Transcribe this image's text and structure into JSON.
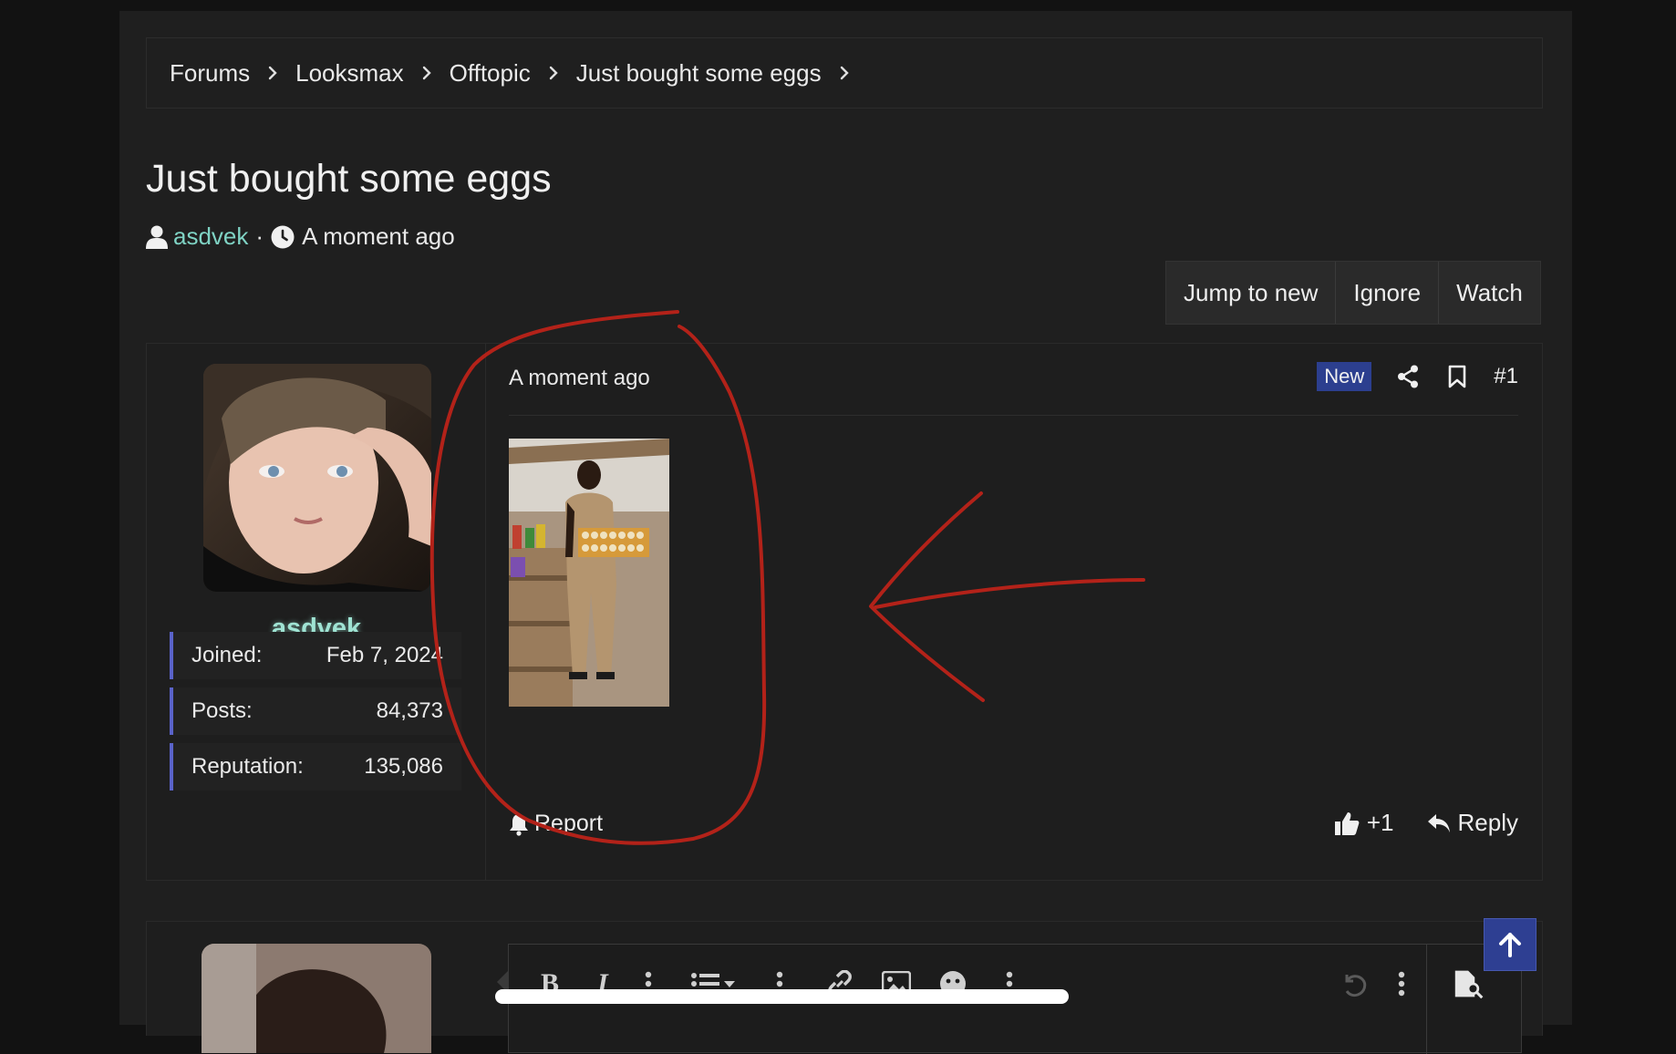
{
  "breadcrumb": {
    "items": [
      "Forums",
      "Looksmax",
      "Offtopic",
      "Just bought some eggs"
    ]
  },
  "thread": {
    "title": "Just bought some eggs",
    "author": "asdvek",
    "separator": "·",
    "time": "A moment ago"
  },
  "actions": {
    "jump_to_new": "Jump to new",
    "ignore": "Ignore",
    "watch": "Watch"
  },
  "post": {
    "time": "A moment ago",
    "badge": "New",
    "number": "#1",
    "report": "Report",
    "reaction_count": "+1",
    "reply": "Reply",
    "user": {
      "name": "asdvek",
      "stats": [
        {
          "label": "Joined:",
          "value": "Feb 7, 2024"
        },
        {
          "label": "Posts:",
          "value": "84,373"
        },
        {
          "label": "Reputation:",
          "value": "135,086"
        }
      ]
    }
  },
  "editor": {
    "bold": "B",
    "italic": "I"
  },
  "colors": {
    "page_bg": "#1f1f1f",
    "outer_bg": "#121212",
    "username_link": "#7fd3c4",
    "badge_new": "#2c3f8f",
    "stat_accent": "#5a63c9",
    "annotation_red": "#b32219",
    "scroll_button": "#2e3f92"
  },
  "icons": {
    "breadcrumb_separator": "chevron-right-icon",
    "author": "user-icon",
    "time": "clock-icon",
    "share": "share-icon",
    "bookmark": "bookmark-icon",
    "report": "bell-icon",
    "like": "thumbs-up-icon",
    "reply": "reply-icon",
    "scroll_top": "arrow-up-icon"
  }
}
